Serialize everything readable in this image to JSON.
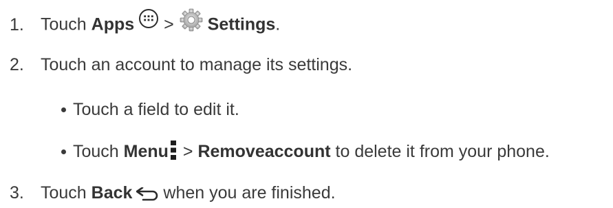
{
  "steps": [
    {
      "number": "1.",
      "prefix": "Touch ",
      "apps_label": "Apps",
      "separator": " > ",
      "settings_label": "Settings",
      "suffix": ".",
      "icons": [
        "apps-icon",
        "settings-gear-icon"
      ]
    },
    {
      "number": "2.",
      "text": "Touch an account to manage its settings."
    },
    {
      "number": "3.",
      "prefix": "Touch ",
      "back_label": "Back",
      "suffix": " when you are finished.",
      "icons": [
        "back-arrow-icon"
      ]
    }
  ],
  "sub_bullets": [
    {
      "text": "Touch a field to edit it."
    },
    {
      "prefix": "Touch ",
      "menu_label": "Menu",
      "separator": " > ",
      "remove_label": "Removeaccount",
      "suffix": " to delete it from your phone.",
      "icons": [
        "menu-dots-icon"
      ]
    }
  ],
  "colors": {
    "text": "#3a3a3a",
    "icon": "#2b2b2b"
  }
}
